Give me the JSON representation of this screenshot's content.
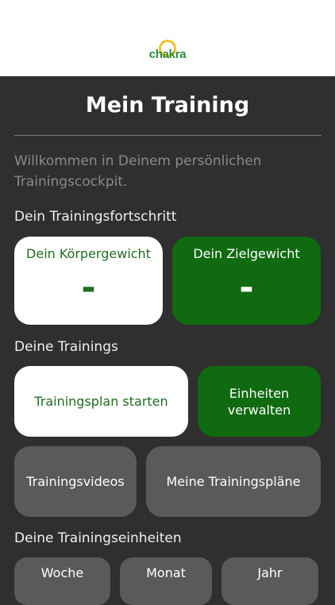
{
  "header": {
    "logo_text": "chakra"
  },
  "page": {
    "title": "Mein Training",
    "welcome": "Willkommen in Deinem persönlichen Trainingscockpit."
  },
  "progress": {
    "section_label": "Dein Trainingsfortschritt",
    "body_weight": {
      "label": "Dein Körpergewicht",
      "value": "-"
    },
    "target_weight": {
      "label": "Dein Zielgewicht",
      "value": "-"
    }
  },
  "trainings": {
    "section_label": "Deine Trainings",
    "start_plan": "Trainingsplan starten",
    "manage_units": "Einheiten verwalten",
    "videos": "Trainingsvideos",
    "my_plans": "Meine Trainingspläne"
  },
  "units": {
    "section_label": "Deine Trainingseinheiten",
    "tabs": [
      "Woche",
      "Monat",
      "Jahr"
    ]
  },
  "colors": {
    "accent_green": "#0f6a10",
    "background": "#2f2f2f",
    "logo_yellow": "#f2c230"
  }
}
